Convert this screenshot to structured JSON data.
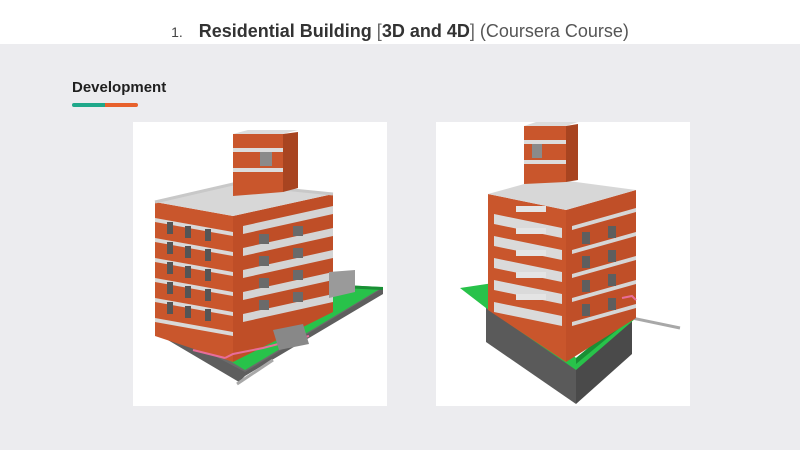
{
  "header": {
    "item_number": "1.",
    "title_main": "Residential Building",
    "bracket_open": "[",
    "title_bold_part": "3D and 4D",
    "bracket_close": "]",
    "title_suffix": "(Coursera Course)"
  },
  "section": {
    "label": "Development",
    "accent_colors": [
      "#1fa88a",
      "#e8612c"
    ]
  },
  "colors": {
    "brick": "#c9562c",
    "concrete": "#d7d7d7",
    "lawn": "#28c24a",
    "base": "#5e5e5e",
    "background": "#ececef"
  },
  "figures": [
    {
      "id": "building-render-front",
      "icon": "3d-building-model"
    },
    {
      "id": "building-render-rear",
      "icon": "3d-building-model"
    }
  ]
}
